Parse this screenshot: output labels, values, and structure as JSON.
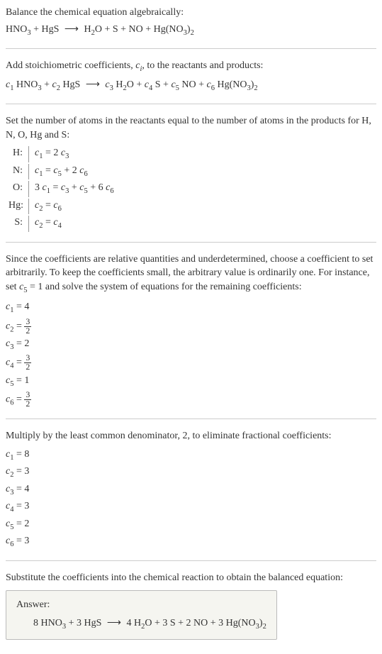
{
  "intro": {
    "line1": "Balance the chemical equation algebraically:",
    "equation_lhs": "HNO₃ + HgS",
    "equation_rhs": "H₂O + S + NO + Hg(NO₃)₂"
  },
  "step2": {
    "text": "Add stoichiometric coefficients, cᵢ, to the reactants and products:",
    "eq_lhs_c1": "c₁",
    "eq_lhs_sp1": " HNO₃ + ",
    "eq_lhs_c2": "c₂",
    "eq_lhs_sp2": " HgS",
    "eq_rhs_c3": "c₃",
    "eq_rhs_sp3": " H₂O + ",
    "eq_rhs_c4": "c₄",
    "eq_rhs_sp4": " S + ",
    "eq_rhs_c5": "c₅",
    "eq_rhs_sp5": " NO + ",
    "eq_rhs_c6": "c₆",
    "eq_rhs_sp6": " Hg(NO₃)₂"
  },
  "step3": {
    "text": "Set the number of atoms in the reactants equal to the number of atoms in the products for H, N, O, Hg and S:",
    "rows": [
      {
        "label": "H:",
        "eq": "c₁ = 2 c₃"
      },
      {
        "label": "N:",
        "eq": "c₁ = c₅ + 2 c₆"
      },
      {
        "label": "O:",
        "eq": "3 c₁ = c₃ + c₅ + 6 c₆"
      },
      {
        "label": "Hg:",
        "eq": "c₂ = c₆"
      },
      {
        "label": "S:",
        "eq": "c₂ = c₄"
      }
    ]
  },
  "step4": {
    "text": "Since the coefficients are relative quantities and underdetermined, choose a coefficient to set arbitrarily. To keep the coefficients small, the arbitrary value is ordinarily one. For instance, set c₅ = 1 and solve the system of equations for the remaining coefficients:",
    "coefs": [
      {
        "lhs": "c₁",
        "rhs": "4",
        "frac": false
      },
      {
        "lhs": "c₂",
        "num": "3",
        "den": "2",
        "frac": true
      },
      {
        "lhs": "c₃",
        "rhs": "2",
        "frac": false
      },
      {
        "lhs": "c₄",
        "num": "3",
        "den": "2",
        "frac": true
      },
      {
        "lhs": "c₅",
        "rhs": "1",
        "frac": false
      },
      {
        "lhs": "c₆",
        "num": "3",
        "den": "2",
        "frac": true
      }
    ]
  },
  "step5": {
    "text": "Multiply by the least common denominator, 2, to eliminate fractional coefficients:",
    "coefs": [
      {
        "lhs": "c₁",
        "rhs": "8"
      },
      {
        "lhs": "c₂",
        "rhs": "3"
      },
      {
        "lhs": "c₃",
        "rhs": "4"
      },
      {
        "lhs": "c₄",
        "rhs": "3"
      },
      {
        "lhs": "c₅",
        "rhs": "2"
      },
      {
        "lhs": "c₆",
        "rhs": "3"
      }
    ]
  },
  "step6": {
    "text": "Substitute the coefficients into the chemical reaction to obtain the balanced equation:"
  },
  "answer": {
    "label": "Answer:",
    "eq_lhs": "8 HNO₃ + 3 HgS",
    "eq_rhs": "4 H₂O + 3 S + 2 NO + 3 Hg(NO₃)₂"
  },
  "arrow": "⟶"
}
